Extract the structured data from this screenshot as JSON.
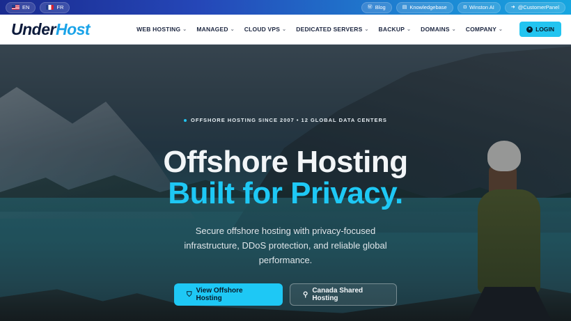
{
  "topbar": {
    "languages": [
      {
        "code": "EN",
        "flag": "us-flag-icon"
      },
      {
        "code": "FR",
        "flag": "fr-flag-icon"
      }
    ],
    "links": [
      {
        "label": "Blog",
        "icon": "wordpress-icon"
      },
      {
        "label": "Knowledgebase",
        "icon": "book-icon"
      },
      {
        "label": "Winston AI",
        "icon": "chat-icon"
      },
      {
        "label": "@CustomerPanel",
        "icon": "login-icon"
      }
    ]
  },
  "brand": {
    "part1": "Under",
    "part2": "Host"
  },
  "nav": {
    "items": [
      {
        "label": "WEB HOSTING"
      },
      {
        "label": "MANAGED"
      },
      {
        "label": "CLOUD VPS"
      },
      {
        "label": "DEDICATED SERVERS"
      },
      {
        "label": "BACKUP"
      },
      {
        "label": "DOMAINS"
      },
      {
        "label": "COMPANY"
      }
    ],
    "login": "LOGIN"
  },
  "hero": {
    "tagline": "OFFSHORE HOSTING SINCE 2007 • 12 GLOBAL DATA CENTERS",
    "headline_line1": "Offshore Hosting",
    "headline_line2": "Built for Privacy.",
    "subtext": "Secure offshore hosting with privacy-focused infrastructure, DDoS protection, and reliable global performance.",
    "cta_primary": "View Offshore Hosting",
    "cta_secondary": "Canada Shared Hosting"
  },
  "colors": {
    "accent": "#1ec8f5",
    "navy": "#0c1a3b",
    "brand_blue": "#1aa3e8"
  }
}
